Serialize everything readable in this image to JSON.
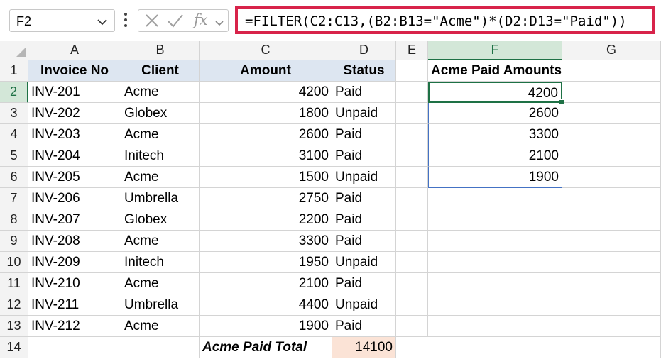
{
  "name_box": {
    "value": "F2"
  },
  "formula_bar": {
    "cancel_icon": "close-icon",
    "enter_icon": "check-icon",
    "fx_label": "fx",
    "formula": "=FILTER(C2:C13,(B2:B13=\"Acme\")*(D2:D13=\"Paid\"))"
  },
  "columns": [
    "A",
    "B",
    "C",
    "D",
    "E",
    "F",
    "G"
  ],
  "rows": [
    "1",
    "2",
    "3",
    "4",
    "5",
    "6",
    "7",
    "8",
    "9",
    "10",
    "11",
    "12",
    "13",
    "14"
  ],
  "headers": {
    "invoice": "Invoice No",
    "client": "Client",
    "amount": "Amount",
    "status": "Status"
  },
  "table": [
    [
      "INV-201",
      "Acme",
      "4200",
      "Paid"
    ],
    [
      "INV-202",
      "Globex",
      "1800",
      "Unpaid"
    ],
    [
      "INV-203",
      "Acme",
      "2600",
      "Paid"
    ],
    [
      "INV-204",
      "Initech",
      "3100",
      "Paid"
    ],
    [
      "INV-205",
      "Acme",
      "1500",
      "Unpaid"
    ],
    [
      "INV-206",
      "Umbrella",
      "2750",
      "Paid"
    ],
    [
      "INV-207",
      "Globex",
      "2200",
      "Paid"
    ],
    [
      "INV-208",
      "Acme",
      "3300",
      "Paid"
    ],
    [
      "INV-209",
      "Initech",
      "1950",
      "Unpaid"
    ],
    [
      "INV-210",
      "Acme",
      "2100",
      "Paid"
    ],
    [
      "INV-211",
      "Umbrella",
      "4400",
      "Unpaid"
    ],
    [
      "INV-212",
      "Acme",
      "1900",
      "Paid"
    ]
  ],
  "total": {
    "label": "Acme Paid Total",
    "value": "14100"
  },
  "filter_result": {
    "header": "Acme Paid Amounts",
    "values": [
      "4200",
      "2600",
      "3300",
      "2100",
      "1900"
    ]
  },
  "colors": {
    "accent_green": "#1e7145",
    "formula_highlight": "#d8234a",
    "header_fill": "#dde6f1",
    "total_fill": "#fbe3d6"
  }
}
